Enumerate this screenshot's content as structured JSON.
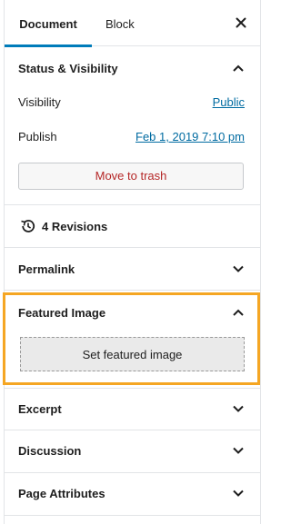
{
  "tabs": {
    "document": "Document",
    "block": "Block"
  },
  "status": {
    "title": "Status & Visibility",
    "visibility_label": "Visibility",
    "visibility_value": "Public",
    "publish_label": "Publish",
    "publish_value": "Feb 1, 2019 7:10 pm",
    "trash_label": "Move to trash"
  },
  "revisions": {
    "label": "4 Revisions"
  },
  "permalink": {
    "title": "Permalink"
  },
  "featured_image": {
    "title": "Featured Image",
    "button_label": "Set featured image",
    "highlight_color": "#f5a623"
  },
  "excerpt": {
    "title": "Excerpt"
  },
  "discussion": {
    "title": "Discussion"
  },
  "page_attributes": {
    "title": "Page Attributes"
  },
  "colors": {
    "accent": "#007cba",
    "link": "#006ba1",
    "danger": "#b52727"
  }
}
